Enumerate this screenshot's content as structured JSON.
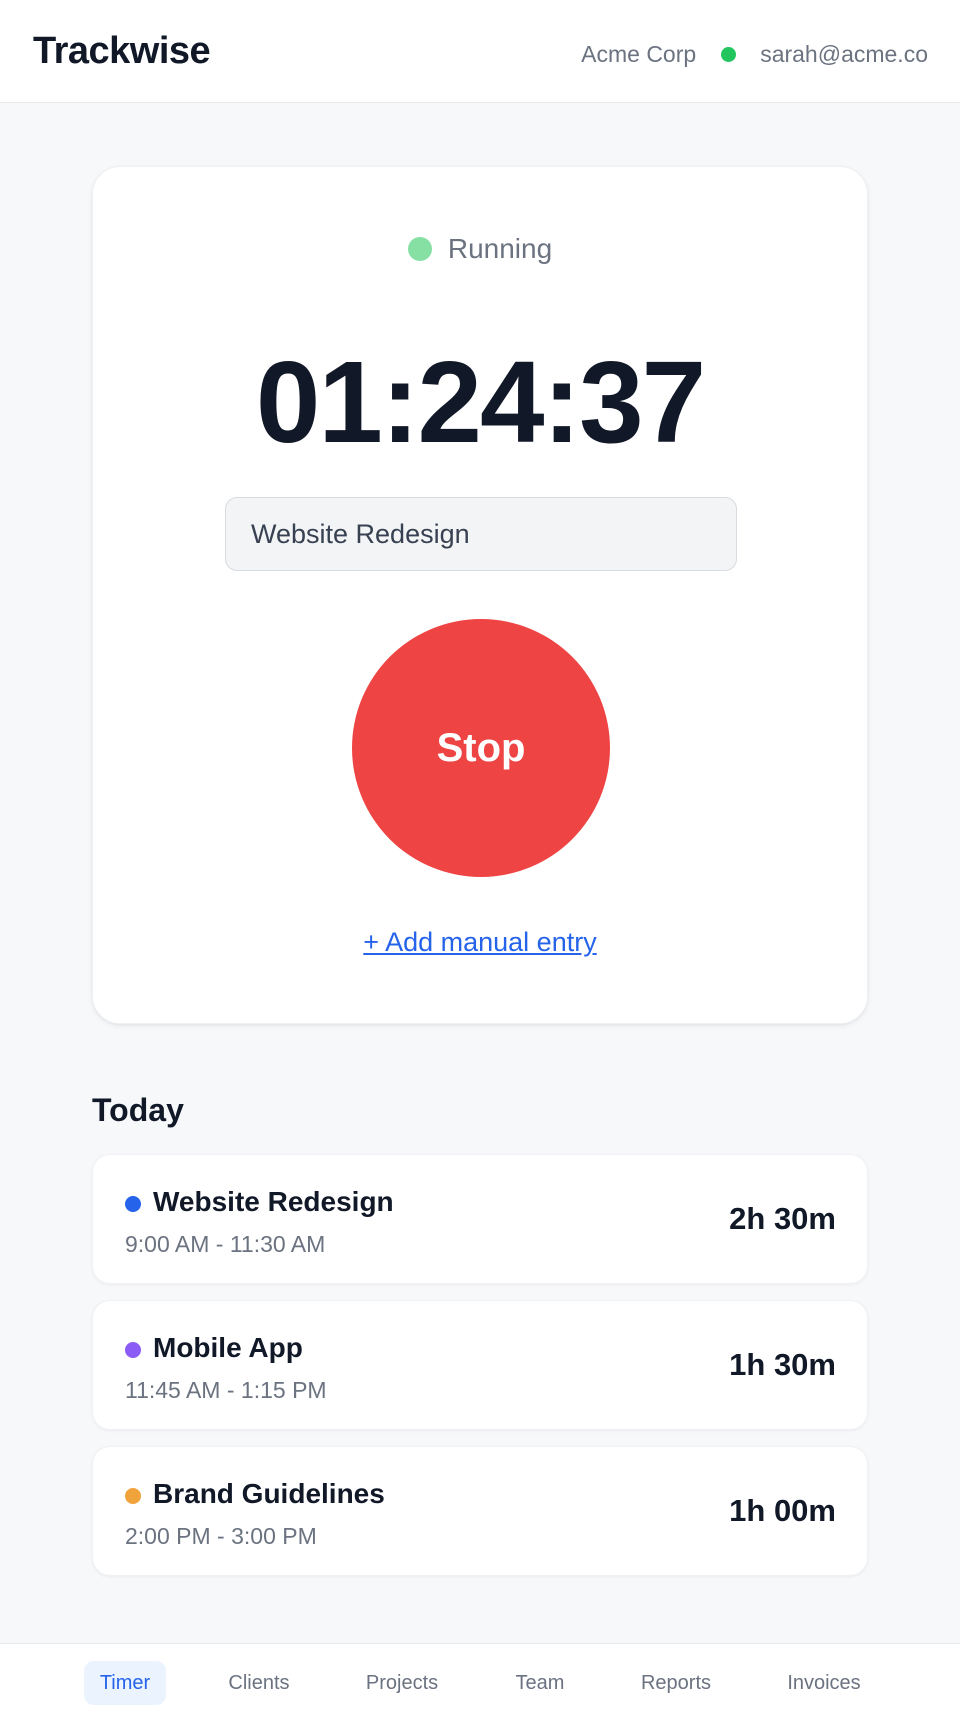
{
  "header": {
    "brand": "Trackwise",
    "org": "Acme Corp",
    "status_color": "#22c55e",
    "email": "sarah@acme.co"
  },
  "timer": {
    "status": "Running",
    "status_color": "#86dfa3",
    "elapsed": "01:24:37",
    "project_value": "Website Redesign",
    "stop_label": "Stop",
    "stop_color": "#ef4444",
    "manual_entry_label": "+ Add manual entry"
  },
  "today": {
    "title": "Today",
    "entries": [
      {
        "project": "Website Redesign",
        "range": "9:00 AM - 11:30 AM",
        "duration": "2h 30m",
        "color": "#2563eb"
      },
      {
        "project": "Mobile App",
        "range": "11:45 AM - 1:15 PM",
        "duration": "1h 30m",
        "color": "#8b5cf6"
      },
      {
        "project": "Brand Guidelines",
        "range": "2:00 PM - 3:00 PM",
        "duration": "1h 00m",
        "color": "#f0a23b"
      }
    ]
  },
  "nav": {
    "active": "Timer",
    "items": [
      {
        "label": "Timer"
      },
      {
        "label": "Clients"
      },
      {
        "label": "Projects"
      },
      {
        "label": "Team"
      },
      {
        "label": "Reports"
      },
      {
        "label": "Invoices"
      }
    ]
  }
}
